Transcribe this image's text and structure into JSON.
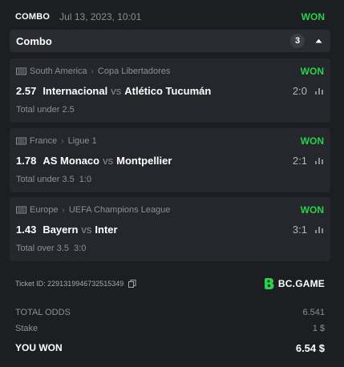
{
  "header": {
    "type": "COMBO",
    "date": "Jul 13, 2023, 10:01",
    "status": "WON"
  },
  "combo": {
    "label": "Combo",
    "count": "3",
    "chevron_icon": "chevron-up-icon"
  },
  "legs": [
    {
      "region": "South America",
      "league": "Copa Libertadores",
      "status": "WON",
      "odds": "2.57",
      "home": "Internacional",
      "vs": "vs",
      "away": "Atlético Tucumán",
      "score": "2:0",
      "market": "Total under 2.5",
      "halftime": ""
    },
    {
      "region": "France",
      "league": "Ligue 1",
      "status": "WON",
      "odds": "1.78",
      "home": "AS Monaco",
      "vs": "vs",
      "away": "Montpellier",
      "score": "2:1",
      "market": "Total under 3.5",
      "halftime": "1:0"
    },
    {
      "region": "Europe",
      "league": "UEFA Champions League",
      "status": "WON",
      "odds": "1.43",
      "home": "Bayern",
      "vs": "vs",
      "away": "Inter",
      "score": "3:1",
      "market": "Total over 3.5",
      "halftime": "3:0"
    }
  ],
  "ticket": {
    "id": "Ticket ID: 2291319946732515349",
    "brand": "BC.GAME"
  },
  "totals": {
    "odds_label": "TOTAL ODDS",
    "odds_value": "6.541",
    "stake_label": "Stake",
    "stake_value": "1 $",
    "won_label": "YOU WON",
    "won_value": "6.54 $"
  },
  "colors": {
    "accent_green": "#28d24a",
    "background": "#1c1e22",
    "panel": "#25272c"
  }
}
